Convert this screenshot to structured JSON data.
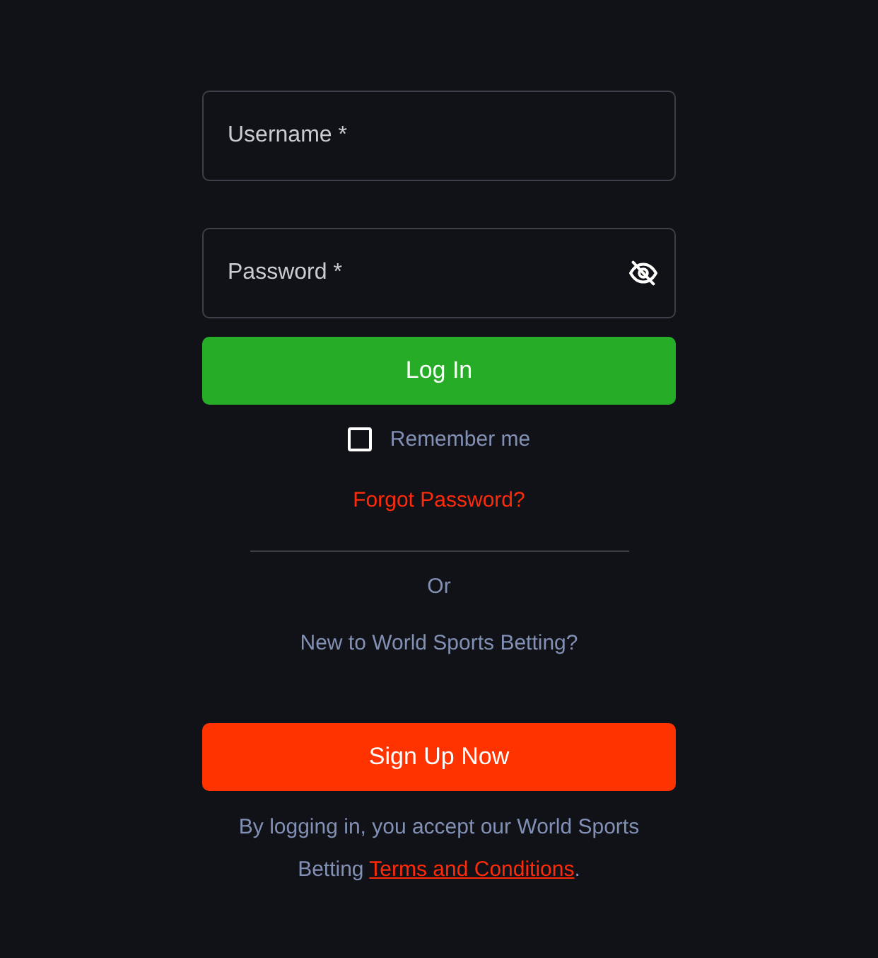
{
  "username": {
    "placeholder": "Username *"
  },
  "password": {
    "placeholder": "Password *",
    "masked": true
  },
  "login_button": "Log In",
  "remember_me": {
    "label": "Remember me",
    "checked": false
  },
  "forgot_password": "Forgot Password?",
  "separator": "Or",
  "signup_prompt": "New to World Sports Betting?",
  "signup_button": "Sign Up Now",
  "legal": {
    "text": "By logging in, you accept our World Sports Betting",
    "link": "Terms and Conditions",
    "after": "."
  }
}
